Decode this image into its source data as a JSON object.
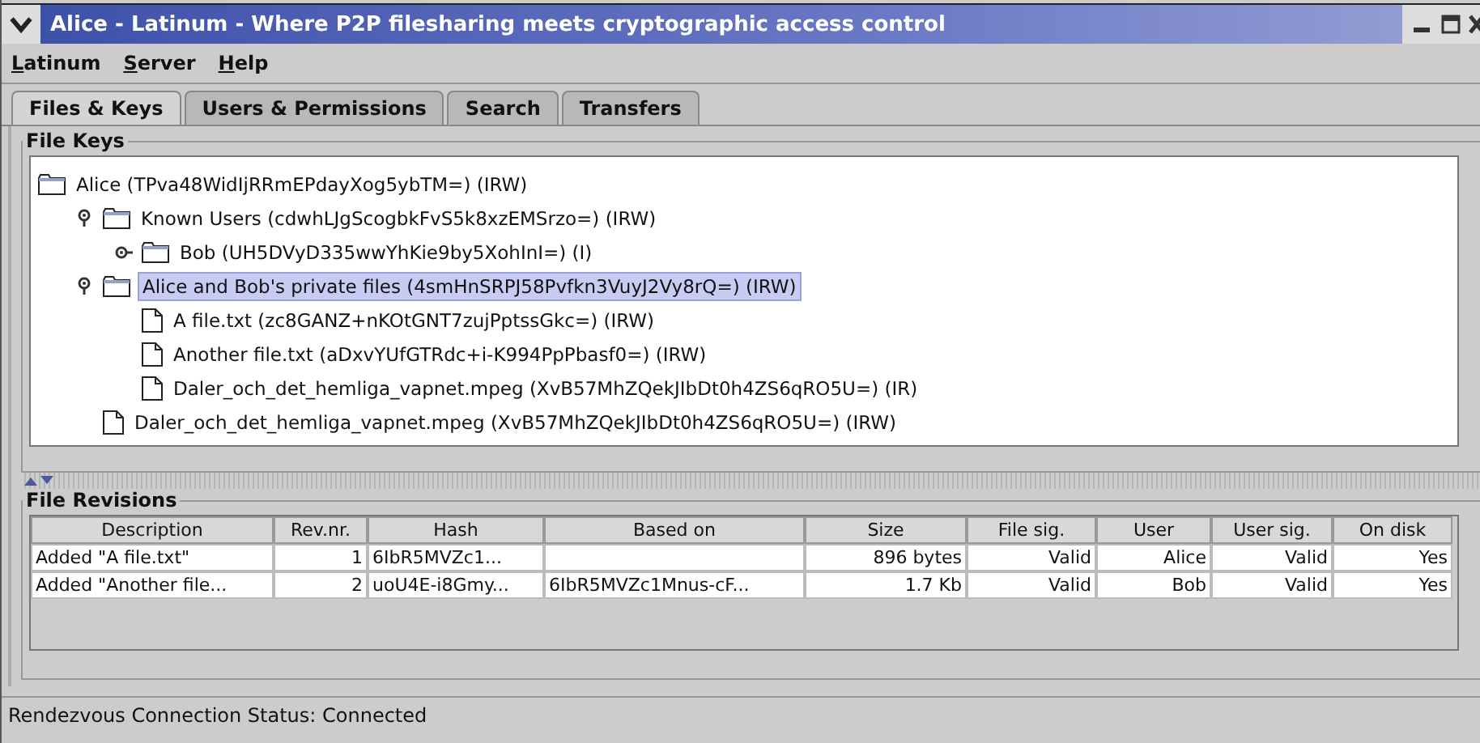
{
  "window": {
    "title": "Alice - Latinum - Where P2P filesharing meets cryptographic access control"
  },
  "menu": [
    "Latinum",
    "Server",
    "Help"
  ],
  "tabs": [
    {
      "label": "Files & Keys",
      "selected": true
    },
    {
      "label": "Users & Permissions",
      "selected": false
    },
    {
      "label": "Search",
      "selected": false
    },
    {
      "label": "Transfers",
      "selected": false
    }
  ],
  "file_keys": {
    "title": "File Keys",
    "tree": {
      "label": "Alice (TPva48WidIjRRmEPdayXog5ybTM=) (IRW)",
      "kind": "folder",
      "selected": false,
      "children": [
        {
          "label": "Known Users (cdwhLJgScogbkFvS5k8xzEMSrzo=) (IRW)",
          "kind": "folder",
          "selected": false,
          "expanded": true,
          "children": [
            {
              "label": "Bob (UH5DVyD335wwYhKie9by5XohInI=) (I)",
              "kind": "folder",
              "selected": false,
              "expanded": false
            }
          ]
        },
        {
          "label": "Alice and Bob's private files (4smHnSRPJ58Pvfkn3VuyJ2Vy8rQ=) (IRW)",
          "kind": "folder",
          "selected": true,
          "expanded": true,
          "children": [
            {
              "label": "A file.txt (zc8GANZ+nKOtGNT7zujPptssGkc=) (IRW)",
              "kind": "file",
              "selected": false
            },
            {
              "label": "Another file.txt (aDxvYUfGTRdc+i-K994PpPbasf0=) (IRW)",
              "kind": "file",
              "selected": false
            },
            {
              "label": "Daler_och_det_hemliga_vapnet.mpeg (XvB57MhZQekJIbDt0h4ZS6qRO5U=) (IR)",
              "kind": "file",
              "selected": false
            }
          ]
        },
        {
          "label": "Daler_och_det_hemliga_vapnet.mpeg (XvB57MhZQekJIbDt0h4ZS6qRO5U=) (IRW)",
          "kind": "file",
          "selected": false
        }
      ]
    }
  },
  "file_revisions": {
    "title": "File Revisions",
    "columns": [
      "Description",
      "Rev.nr.",
      "Hash",
      "Based on",
      "Size",
      "File sig.",
      "User",
      "User sig.",
      "On disk"
    ],
    "rows": [
      [
        "Added \"A file.txt\"",
        "1",
        "6IbR5MVZc1...",
        "",
        "896 bytes",
        "Valid",
        "Alice",
        "Valid",
        "Yes"
      ],
      [
        "Added \"Another file...",
        "2",
        "uoU4E-i8Gmy...",
        "6IbR5MVZc1Mnus-cF...",
        "1.7 Kb",
        "Valid",
        "Bob",
        "Valid",
        "Yes"
      ]
    ]
  },
  "status_bar": "Rendezvous Connection Status: Connected"
}
